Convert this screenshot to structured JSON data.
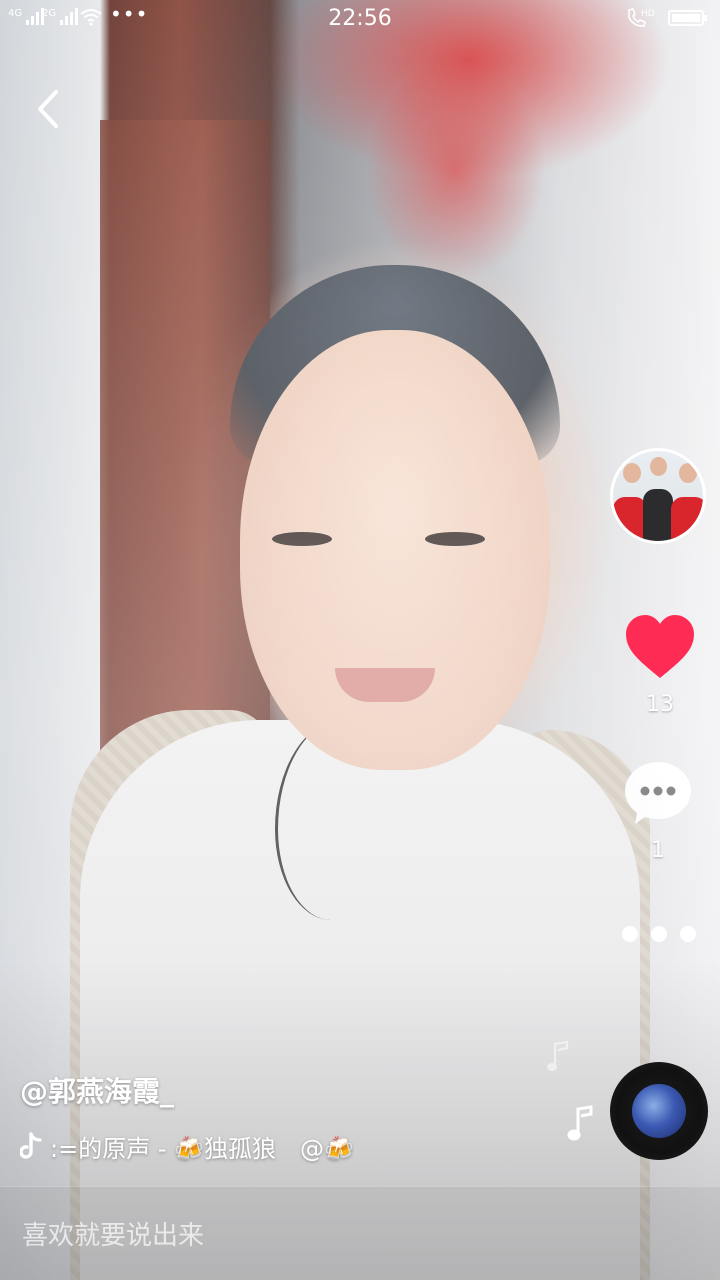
{
  "status_bar": {
    "network_1": "4G",
    "network_2": "2G",
    "overflow_dots": "•••",
    "time": "22:56",
    "call_badge": "HD",
    "battery_level": 0.88
  },
  "video": {
    "author_handle": "@郭燕海霞_",
    "music_text": ":=的原声 - 🍻独孤狼　@🍻"
  },
  "actions": {
    "like_count": "13",
    "comment_count": "1",
    "like_color": "#fe2c55"
  },
  "comment_bar": {
    "placeholder": "喜欢就要说出来"
  },
  "icons": {
    "back": "chevron-left-icon",
    "like": "heart-icon",
    "comment": "speech-bubble-icon",
    "more": "ellipsis-icon",
    "music": "music-note-icon",
    "brand": "tiktok-note-icon"
  }
}
